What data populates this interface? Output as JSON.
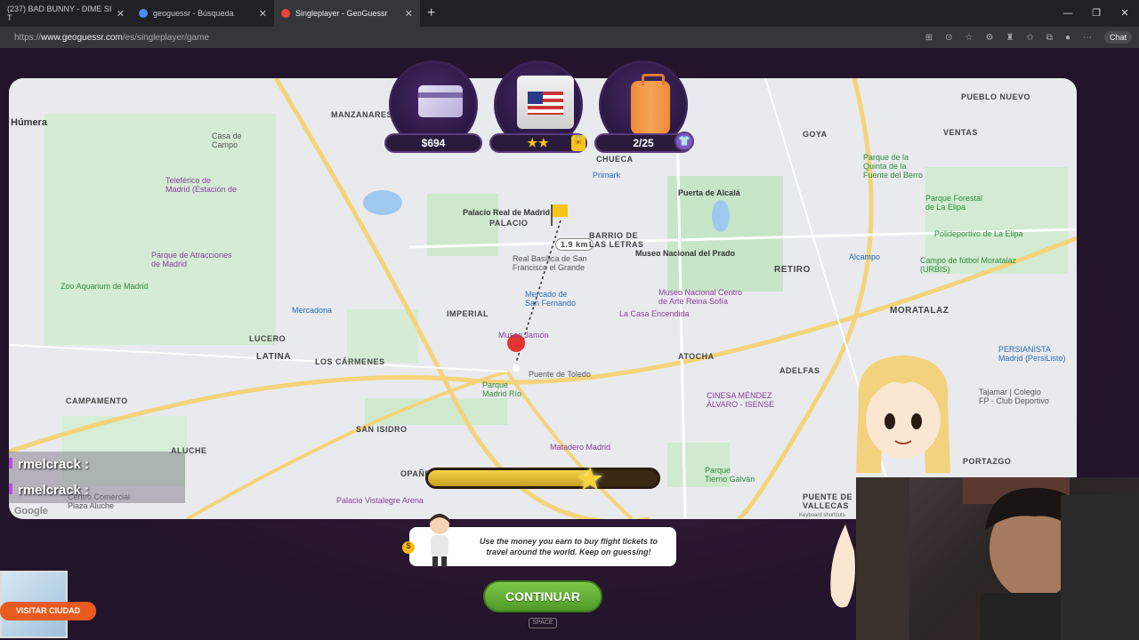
{
  "browser": {
    "tabs": [
      {
        "label": "(237) BAD BUNNY - DIME SI T",
        "active": false,
        "favicon_color": "#ff0000"
      },
      {
        "label": "geoguessr - Búsqueda",
        "active": false,
        "favicon_color": "#4a8af4"
      },
      {
        "label": "Singleplayer - GeoGuessr",
        "active": true,
        "favicon_color": "#e8453c"
      }
    ],
    "new_tab": "+",
    "url_prefix": "https://",
    "url_host": "www.geoguessr.com",
    "url_path": "/es/singleplayer/game",
    "chat_label": "Chat"
  },
  "hud": {
    "money": "$694",
    "suitcase_count": "2/25"
  },
  "map": {
    "distance_label": "1.9 km",
    "labels": {
      "humera": "Húmera",
      "manzanares": "MANZANARES",
      "casa_campo": "Casa de\nCampo",
      "teleferico": "Teleférico de\nMadrid (Estación de",
      "parque_atracciones": "Parque de Atracciones\nde Madrid",
      "zoo": "Zoo Aquarium de Madrid",
      "lucero": "LUCERO",
      "latina": "LATINA",
      "los_carmenes": "LOS CÁRMENES",
      "campamento": "CAMPAMENTO",
      "san_isidro": "SAN ISIDRO",
      "aluche": "ALUCHE",
      "opanel": "OPAÑEL",
      "imperial": "IMPERIAL",
      "palacio": "PALACIO",
      "palacio_real": "Palacio Real de Madrid",
      "chueca": "CHUECA",
      "primark": "Primark",
      "barrio_letras": "BARRIO DE\nLAS LETRAS",
      "museo_prado": "Museo Nacional del Prado",
      "puerta_alcala": "Puerta de Alcalá",
      "retiro": "RETIRO",
      "goya": "GOYA",
      "ventas": "VENTAS",
      "pueblo_nuevo": "PUEBLO NUEVO",
      "quinta": "Parque de la\nQuinta de la\nFuente del Berro",
      "elipa": "Parque Forestal\nde La Elipa",
      "polideportivo": "Polideportivo de La Elipa",
      "alcampo": "Alcampo",
      "campo_futbol": "Campo de fútbol Moratalaz\n(URBIS)",
      "moratalaz": "MORATALAZ",
      "persianista": "PERSIANISTA\nMadrid (PersiListo)",
      "tajamar": "Tajamar | Colegio\nFP - Club Deportivo",
      "reina_sofia": "Museo Nacional Centro\nde Arte Reina Sofía",
      "casa_encendida": "La Casa Encendida",
      "atocha": "ATOCHA",
      "adelfas": "ADELFAS",
      "cinesa": "CINESA MÉNDEZ\nÁLVARO - ISENSE",
      "mercadona": "Mercadona",
      "san_francisco": "Real Basílica de San\nFrancisco el Grande",
      "mercado_fernando": "Mercado de\nSan Fernando",
      "museo_jamon": "Museo Jamón",
      "puente_toledo": "Puente de Toledo",
      "parque_madrid_rio": "Parque\nMadrid Río",
      "matadero": "Matadero Madrid",
      "palacio_vistalegre": "Palacio Vistalegre Arena",
      "centro_comercial": "Centro Comercial\nPlaza Aluche",
      "puente_vallecas": "PUENTE DE\nVALLECAS",
      "portazgo": "PORTAZGO",
      "tierno_galvan": "Parque\nTierno Galván",
      "google": "Google",
      "keyboard": "Keyboard shortcuts"
    }
  },
  "chat": [
    {
      "user": "rmelcrack :"
    },
    {
      "user": "rmelcrack :"
    }
  ],
  "progress": {
    "fraction": 0.7
  },
  "tip": {
    "text": "Use the money you earn to buy flight tickets to travel around the world. Keep on guessing!"
  },
  "actions": {
    "continue": "CONTINUAR",
    "space": "SPACE",
    "visit_city": "VISITAR CIUDAD"
  },
  "colors": {
    "accent_green": "#5aad2e",
    "accent_orange": "#e85a1e",
    "hud_purple": "#2a1842"
  }
}
